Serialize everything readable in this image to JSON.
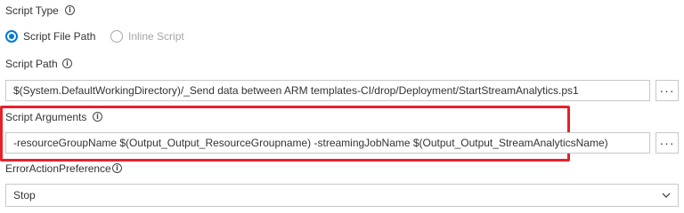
{
  "script_type": {
    "label": "Script Type",
    "options": [
      {
        "label": "Script File Path",
        "selected": true
      },
      {
        "label": "Inline Script",
        "selected": false
      }
    ]
  },
  "script_path": {
    "label": "Script Path",
    "value": "$(System.DefaultWorkingDirectory)/_Send data between ARM templates-CI/drop/Deployment/StartStreamAnalytics.ps1",
    "browse_label": "···"
  },
  "script_arguments": {
    "label": "Script Arguments",
    "value": "-resourceGroupName $(Output_Output_ResourceGroupname) -streamingJobName $(Output_Output_StreamAnalyticsName)",
    "browse_label": "···"
  },
  "error_action": {
    "label": "ErrorActionPreference",
    "selected": "Stop"
  },
  "info_glyph": "i",
  "colors": {
    "accent": "#0078d4",
    "highlight": "#e8202a",
    "border": "#c8c8c8"
  }
}
